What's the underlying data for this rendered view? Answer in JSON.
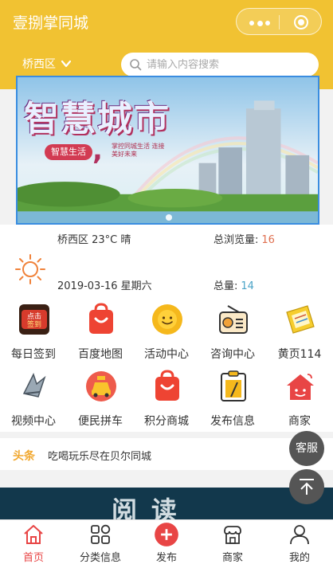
{
  "header": {
    "title": "壹捌掌同城"
  },
  "location": {
    "district": "桥西区"
  },
  "search": {
    "placeholder": "请输入内容搜索"
  },
  "banner": {
    "title": "智慧城市",
    "tag": "智慧生活",
    "slogan": "掌控同城生活 连接美好未来"
  },
  "weather": {
    "location_temp": "桥西区 23°C 晴",
    "date": "2019-03-16 星期六"
  },
  "stats": {
    "views_label": "总浏览量:",
    "views_value": "16",
    "total_label": "总量:",
    "total_value": "14"
  },
  "grid": [
    {
      "label": "每日签到",
      "icon": "sign-in-icon"
    },
    {
      "label": "百度地图",
      "icon": "shopping-bag-icon"
    },
    {
      "label": "活动中心",
      "icon": "smiley-sun-icon"
    },
    {
      "label": "咨询中心",
      "icon": "radio-icon"
    },
    {
      "label": "黄页114",
      "icon": "yellow-pages-icon"
    },
    {
      "label": "视频中心",
      "icon": "video-icon"
    },
    {
      "label": "便民拼车",
      "icon": "taxi-icon"
    },
    {
      "label": "积分商城",
      "icon": "shopping-bag-icon"
    },
    {
      "label": "发布信息",
      "icon": "clipboard-icon"
    },
    {
      "label": "商家",
      "icon": "store-icon"
    }
  ],
  "headline": {
    "tag": "头条",
    "text": "吃喝玩乐尽在贝尔同城"
  },
  "promo": {
    "text": "阅读"
  },
  "float": {
    "service_label": "客服"
  },
  "tabbar": [
    {
      "label": "首页",
      "icon": "home-icon",
      "active": true
    },
    {
      "label": "分类信息",
      "icon": "category-icon",
      "active": false
    },
    {
      "label": "发布",
      "icon": "plus-icon",
      "active": false
    },
    {
      "label": "商家",
      "icon": "merchant-icon",
      "active": false
    },
    {
      "label": "我的",
      "icon": "user-icon",
      "active": false
    }
  ],
  "colors": {
    "brand": "#f1c232",
    "accent_red": "#e84545",
    "headline_tag": "#f1a830"
  }
}
